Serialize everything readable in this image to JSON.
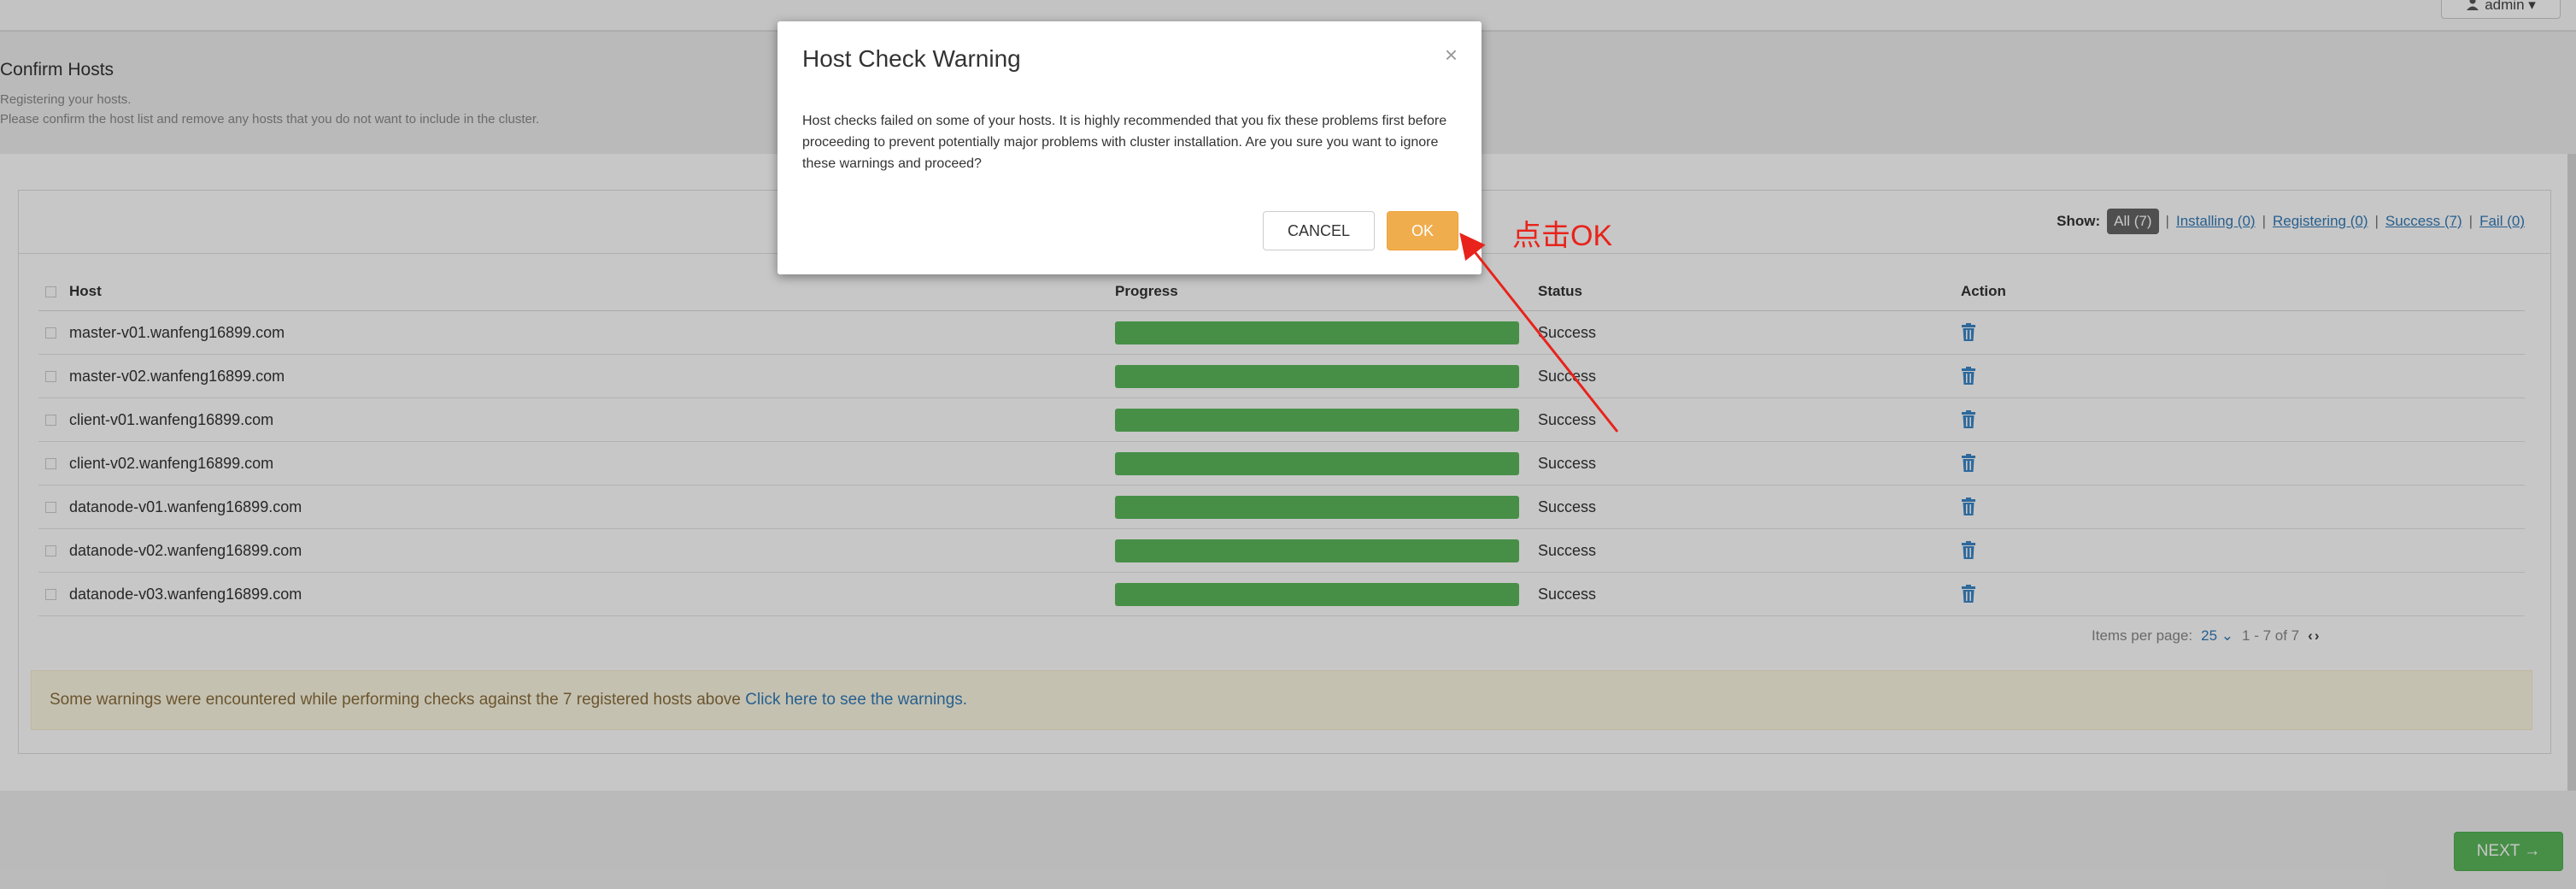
{
  "topbar": {
    "user_label": "admin ▾"
  },
  "page": {
    "title": "Confirm Hosts",
    "subtitle1": "Registering your hosts.",
    "subtitle2": "Please confirm the host list and remove any hosts that you do not want to include in the cluster."
  },
  "filters": {
    "show_label": "Show:",
    "all": "All (7)",
    "installing": "Installing (0)",
    "registering": "Registering (0)",
    "success": "Success (7)",
    "fail": "Fail (0)",
    "separator": "|"
  },
  "table": {
    "headers": {
      "host": "Host",
      "progress": "Progress",
      "status": "Status",
      "action": "Action"
    },
    "rows": [
      {
        "host": "master-v01.wanfeng16899.com",
        "status": "Success",
        "progress": 1.0
      },
      {
        "host": "master-v02.wanfeng16899.com",
        "status": "Success",
        "progress": 1.0
      },
      {
        "host": "client-v01.wanfeng16899.com",
        "status": "Success",
        "progress": 1.0
      },
      {
        "host": "client-v02.wanfeng16899.com",
        "status": "Success",
        "progress": 1.0
      },
      {
        "host": "datanode-v01.wanfeng16899.com",
        "status": "Success",
        "progress": 1.0
      },
      {
        "host": "datanode-v02.wanfeng16899.com",
        "status": "Success",
        "progress": 1.0
      },
      {
        "host": "datanode-v03.wanfeng16899.com",
        "status": "Success",
        "progress": 1.0
      }
    ]
  },
  "pager": {
    "label": "Items per page:",
    "value": "25",
    "range": "1 - 7 of 7"
  },
  "warning": {
    "text": "Some warnings were encountered while performing checks against the 7 registered hosts above",
    "link": "Click here to see the warnings."
  },
  "footer": {
    "next_label": "NEXT →"
  },
  "modal": {
    "title": "Host Check Warning",
    "close": "×",
    "body": "Host checks failed on some of your hosts. It is highly recommended that you fix these problems first before proceeding to prevent potentially major problems with cluster installation. Are you sure you want to ignore these warnings and proceed?",
    "cancel_label": "CANCEL",
    "ok_label": "OK"
  },
  "annotation": {
    "text": "点击OK",
    "color": "#e8231b"
  },
  "colors": {
    "success": "#5cb85c",
    "primary": "#337ab7",
    "warning_bg": "#fcf8e3",
    "ok_button": "#f0ad4e"
  },
  "icons": {
    "trash": "trash-icon",
    "user": "user-icon",
    "close": "close-icon"
  }
}
